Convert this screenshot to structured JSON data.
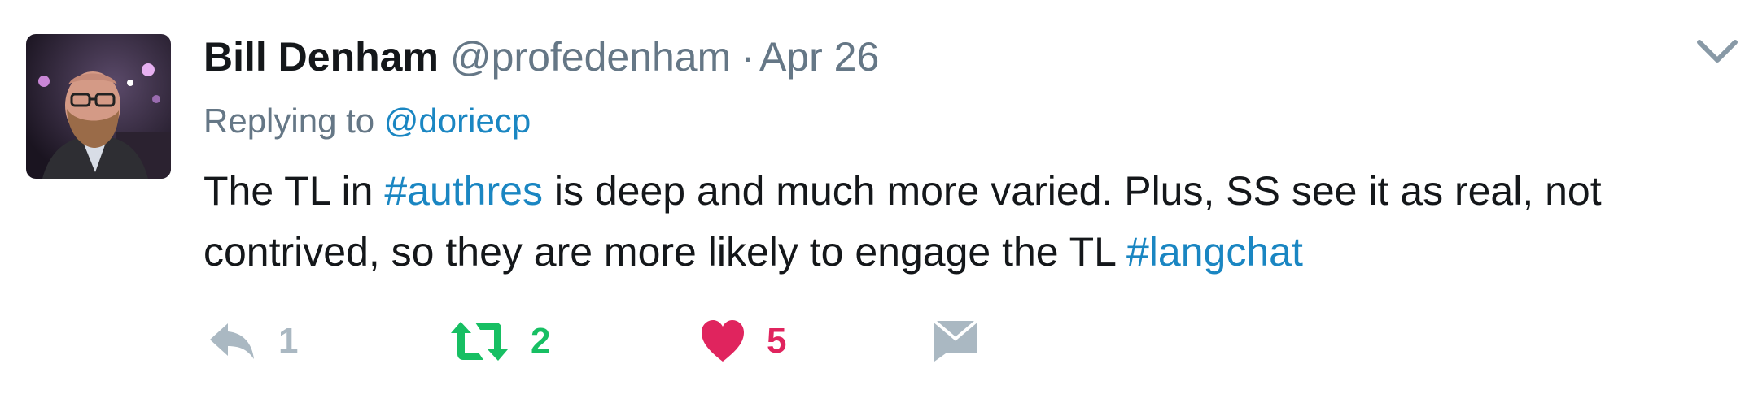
{
  "tweet": {
    "author": {
      "name": "Bill Denham",
      "handle": "@profedenham",
      "avatar": "user-photo"
    },
    "separator": "·",
    "date": "Apr 26",
    "replying_prefix": "Replying to",
    "replying_to": "@doriecp",
    "text": {
      "line1_before": "The TL in",
      "hashtag1": "#authres",
      "line1_after": "is deep and much more varied. Plus, SS see it as real, not",
      "line2_before": "contrived, so they are more likely to engage the TL",
      "hashtag2": "#langchat"
    },
    "actions": {
      "reply": {
        "icon": "reply-icon",
        "count": "1"
      },
      "retweet": {
        "icon": "retweet-icon",
        "count": "2"
      },
      "like": {
        "icon": "heart-icon",
        "count": "5"
      },
      "message": {
        "icon": "envelope-icon"
      }
    },
    "menu_icon": "chevron-down-icon"
  },
  "colors": {
    "text": "#14171a",
    "muted": "#657786",
    "link": "#1a86c2",
    "retweet": "#17bf63",
    "like": "#e0245e",
    "icon_gray": "#aab8c2"
  }
}
